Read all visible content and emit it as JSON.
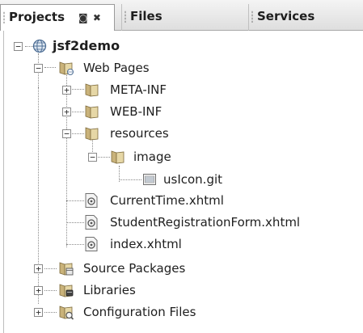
{
  "tabs": {
    "projects": "Projects",
    "files": "Files",
    "services": "Services",
    "projects_tools": {
      "minimize": "◙",
      "close": "✖"
    }
  },
  "tree": {
    "root": "jsf2demo",
    "web_pages": "Web Pages",
    "meta_inf": "META-INF",
    "web_inf": "WEB-INF",
    "resources": "resources",
    "image": "image",
    "us_icon": "usIcon.git",
    "current_time": "CurrentTime.xhtml",
    "student_form": "StudentRegistrationForm.xhtml",
    "index": "index.xhtml",
    "source_packages": "Source Packages",
    "libraries": "Libraries",
    "config_files": "Configuration Files"
  },
  "expanders": {
    "expanded": "−",
    "collapsed": "+"
  },
  "icons": {
    "globe": "globe-icon",
    "web_folder": "web-pages-folder-icon",
    "folder": "folder-icon",
    "image_file": "image-file-icon",
    "xhtml_file": "xhtml-file-icon",
    "packages": "source-packages-icon",
    "libraries": "libraries-icon",
    "config": "configuration-files-icon"
  },
  "colors": {
    "folder": "#d8c48a",
    "globe": "#5a7fa8",
    "file": "#e8e8e8"
  }
}
